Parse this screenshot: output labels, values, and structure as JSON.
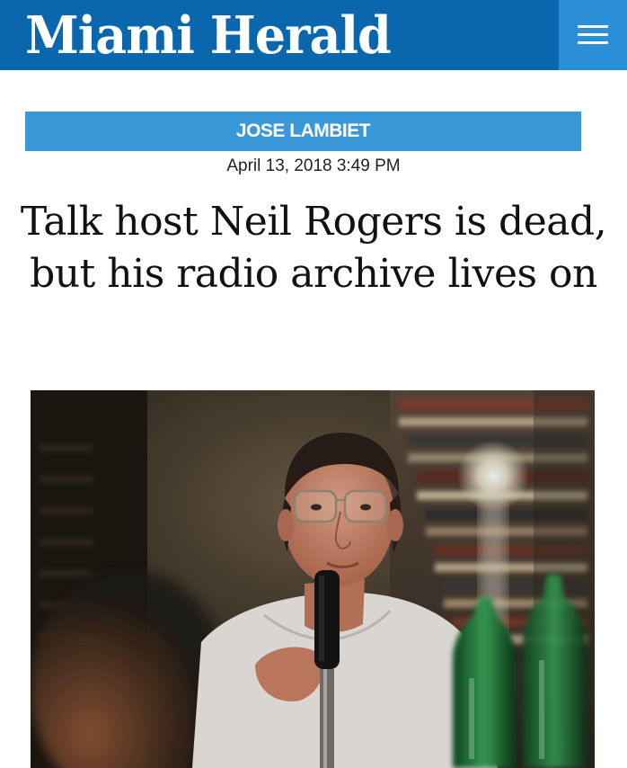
{
  "header": {
    "logo_text": "Miami Herald",
    "menu_icon": "hamburger-menu-icon",
    "bar_color": "#0a66ad",
    "menu_color": "#2a8fd6"
  },
  "article": {
    "author": "JOSE LAMBIET",
    "author_band_color": "#3a98d8",
    "date": "April 13, 2018 3:49 PM",
    "headline": "Talk host Neil Rogers is dead, but his radio archive lives on"
  }
}
